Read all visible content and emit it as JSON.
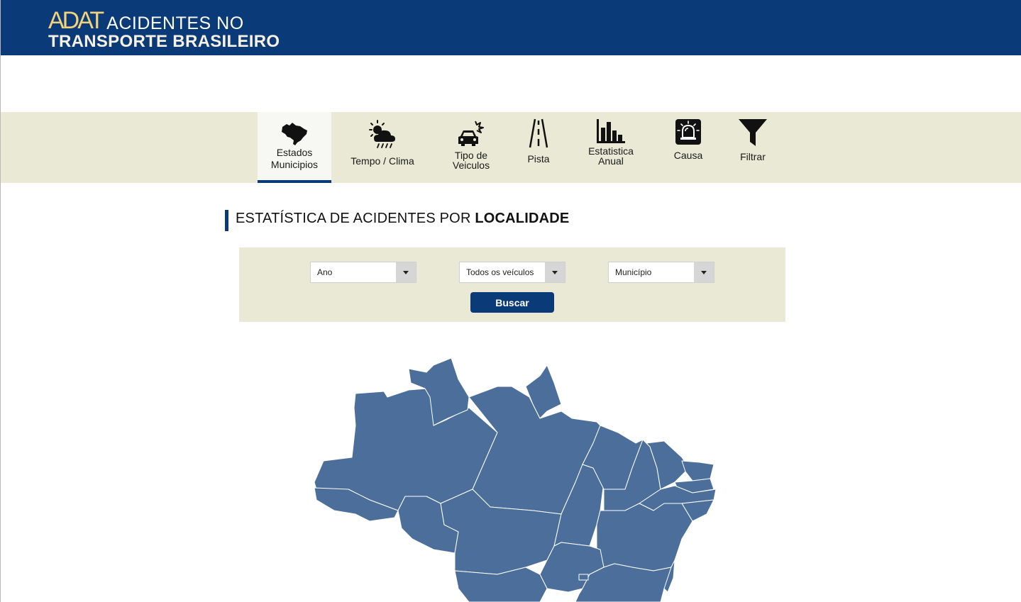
{
  "header": {
    "logo": "ADAT",
    "tagline_top": "ACIDENTES NO",
    "tagline_bottom": "TRANSPORTE BRASILEIRO",
    "bg_color": "#0b3a78",
    "logo_color": "#f3d37a"
  },
  "nav": {
    "active": "Estados Municipios",
    "items": [
      {
        "line1": "Estados",
        "line2": "Municipios",
        "icon": "brazil-map-icon"
      },
      {
        "line1": "Tempo / Clima",
        "line2": "",
        "icon": "weather-icon"
      },
      {
        "line1": "Tipo de",
        "line2": "Veiculos",
        "icon": "car-crash-icon"
      },
      {
        "line1": "Pista",
        "line2": "",
        "icon": "road-icon"
      },
      {
        "line1": "Estatistica",
        "line2": "Anual",
        "icon": "bar-chart-icon"
      },
      {
        "line1": "Causa",
        "line2": "",
        "icon": "siren-icon"
      },
      {
        "line1": "Filtrar",
        "line2": "",
        "icon": "funnel-icon"
      }
    ]
  },
  "section": {
    "title_prefix": "ESTATÍSTICA DE ACIDENTES POR ",
    "title_bold": "LOCALIDADE"
  },
  "filters": {
    "year": {
      "value": "Ano"
    },
    "vehicle": {
      "value": "Todos os veículos"
    },
    "city": {
      "value": "Município"
    },
    "search_label": "Buscar"
  },
  "map": {
    "icon": "brazil-states-map",
    "fill_color": "#4b6e9b"
  }
}
